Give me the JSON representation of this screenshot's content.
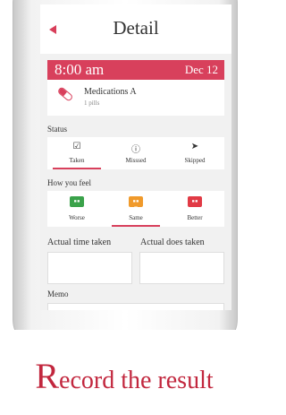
{
  "header": {
    "title": "Detail"
  },
  "schedule": {
    "time": "8:00 am",
    "date": "Dec 12"
  },
  "medication": {
    "name": "Medications A",
    "dose": "1 pills"
  },
  "status": {
    "label": "Status",
    "options": [
      {
        "label": "Taken",
        "icon": "checkbox-icon"
      },
      {
        "label": "Misssed",
        "icon": "alert-circle-icon"
      },
      {
        "label": "Skipped",
        "icon": "cursor-arrow-icon"
      }
    ],
    "selected": "Taken"
  },
  "feel": {
    "label": "How you feel",
    "options": [
      {
        "label": "Worse",
        "icon": "sad-face-icon",
        "color": "#3aa24a"
      },
      {
        "label": "Same",
        "icon": "neutral-face-icon",
        "color": "#f09a2b"
      },
      {
        "label": "Better",
        "icon": "happy-face-icon",
        "color": "#e13a45"
      }
    ],
    "selected": "Same"
  },
  "actual_time": {
    "label": "Actual time taken"
  },
  "actual_dose": {
    "label": "Actual does taken"
  },
  "memo": {
    "label": "Memo"
  },
  "tagline": {
    "first_letter": "R",
    "rest": "ecord the result"
  },
  "colors": {
    "accent": "#d8405c",
    "tagline": "#c2273e"
  }
}
